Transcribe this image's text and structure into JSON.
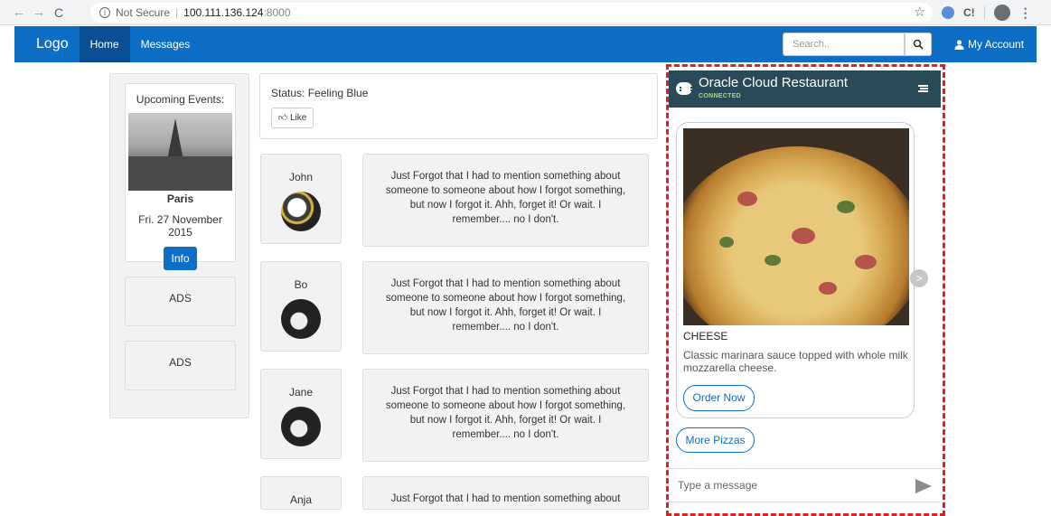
{
  "browser": {
    "not_secure": "Not Secure",
    "host": "100.111.136.124",
    "port": ":8000"
  },
  "navbar": {
    "brand": "Logo",
    "items": [
      {
        "label": "Home",
        "active": true
      },
      {
        "label": "Messages",
        "active": false
      }
    ],
    "search_placeholder": "Search..",
    "account": "My Account"
  },
  "events": {
    "title": "Upcoming Events:",
    "city": "Paris",
    "date": "Fri. 27 November 2015",
    "info_button": "Info"
  },
  "ads": [
    "ADS",
    "ADS"
  ],
  "status": {
    "text": "Status: Feeling Blue",
    "like": "Like"
  },
  "posts": [
    {
      "user": "John",
      "text": "Just Forgot that I had to mention something about someone to someone about how I forgot something, but now I forgot it. Ahh, forget it! Or wait. I remember.... no I don't."
    },
    {
      "user": "Bo",
      "text": "Just Forgot that I had to mention something about someone to someone about how I forgot something, but now I forgot it. Ahh, forget it! Or wait. I remember.... no I don't."
    },
    {
      "user": "Jane",
      "text": "Just Forgot that I had to mention something about someone to someone about how I forgot something, but now I forgot it. Ahh, forget it! Or wait. I remember.... no I don't."
    },
    {
      "user": "Anja",
      "text": "Just Forgot that I had to mention something about"
    }
  ],
  "chat": {
    "title": "Oracle Cloud Restaurant",
    "status": "CONNECTED",
    "card": {
      "name": "CHEESE",
      "description": "Classic marinara sauce topped with whole milk mozzarella cheese.",
      "order_button": "Order Now"
    },
    "more_button": "More Pizzas",
    "input_placeholder": "Type a message",
    "header_color": "#2b4a57",
    "accent_color": "#0d6ec6"
  }
}
